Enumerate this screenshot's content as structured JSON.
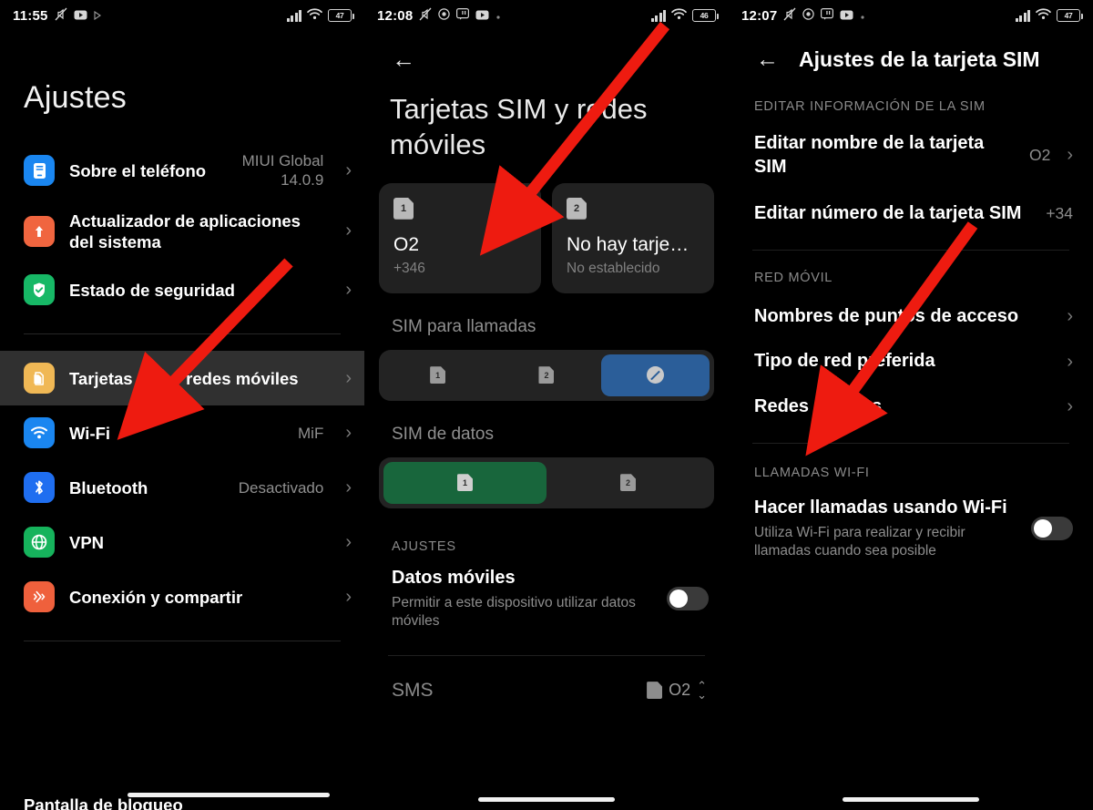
{
  "panel1": {
    "statusbar": {
      "time": "11:55",
      "battery": "47",
      "icons": [
        "mute-icon",
        "youtube-icon",
        "play-icon",
        "signal-icon",
        "wifi-icon",
        "battery-icon"
      ]
    },
    "title": "Ajustes",
    "items": [
      {
        "label": "Sobre el teléfono",
        "value": "MIUI Global\n14.0.9",
        "icon": "phone-info-icon",
        "color": "#1a86f0",
        "selected": false
      },
      {
        "label": "Actualizador de aplicaciones del sistema",
        "value": "",
        "icon": "system-update-icon",
        "color": "#f0653f",
        "selected": false
      },
      {
        "label": "Estado de seguridad",
        "value": "",
        "icon": "security-shield-icon",
        "color": "#17b866",
        "selected": false
      },
      {
        "label": "Tarjetas SIM y redes móviles",
        "value": "",
        "icon": "sim-card-icon",
        "color": "#f0b855",
        "selected": true
      },
      {
        "label": "Wi-Fi",
        "value": "MiF",
        "icon": "wifi-icon",
        "color": "#1a86f0",
        "selected": false
      },
      {
        "label": "Bluetooth",
        "value": "Desactivado",
        "icon": "bluetooth-icon",
        "color": "#1f6ef0",
        "selected": false
      },
      {
        "label": "VPN",
        "value": "",
        "icon": "vpn-globe-icon",
        "color": "#16b35c",
        "selected": false
      },
      {
        "label": "Conexión y compartir",
        "value": "",
        "icon": "connection-share-icon",
        "color": "#ef603c",
        "selected": false
      }
    ],
    "bottom_partial": "Pantalla de bloqueo"
  },
  "panel2": {
    "statusbar": {
      "time": "12:08",
      "battery": "46"
    },
    "back_label": "←",
    "title": "Tarjetas SIM y redes móviles",
    "sim_cards": [
      {
        "slot": "1",
        "name": "O2",
        "sub": "+346"
      },
      {
        "slot": "2",
        "name": "No hay tarje…",
        "sub": "No establecido"
      }
    ],
    "calls_section": {
      "header": "SIM para llamadas",
      "options": [
        "1",
        "2",
        "ask"
      ],
      "selected_index": 2
    },
    "data_section": {
      "header": "SIM de datos",
      "options": [
        "1",
        "2"
      ],
      "selected_index": 0
    },
    "settings_caption": "AJUSTES",
    "mobile_data": {
      "title": "Datos móviles",
      "subtitle": "Permitir a este dispositivo utilizar datos móviles",
      "enabled": false
    },
    "sms_row": {
      "label": "SMS",
      "value": "O2"
    }
  },
  "panel3": {
    "statusbar": {
      "time": "12:07",
      "battery": "47"
    },
    "title": "Ajustes de la tarjeta SIM",
    "sections": [
      {
        "caption": "EDITAR INFORMACIÓN DE LA SIM",
        "rows": [
          {
            "label": "Editar nombre de la tarjeta SIM",
            "value": "O2",
            "chevron": true
          },
          {
            "label": "Editar número de la tarjeta SIM",
            "value": "+34",
            "chevron": false
          }
        ]
      },
      {
        "caption": "RED MÓVIL",
        "rows": [
          {
            "label": "Nombres de puntos de acceso",
            "value": "",
            "chevron": true
          },
          {
            "label": "Tipo de red preferida",
            "value": "",
            "chevron": true
          },
          {
            "label": "Redes móviles",
            "value": "",
            "chevron": true
          }
        ]
      }
    ],
    "wifi_calling": {
      "caption": "LLAMADAS WI-FI",
      "title": "Hacer llamadas usando Wi-Fi",
      "subtitle": "Utiliza Wi-Fi para realizar y recibir llamadas cuando sea posible",
      "enabled": false
    }
  },
  "annotations": {
    "arrow_color": "#ee1b10",
    "count": 3
  }
}
